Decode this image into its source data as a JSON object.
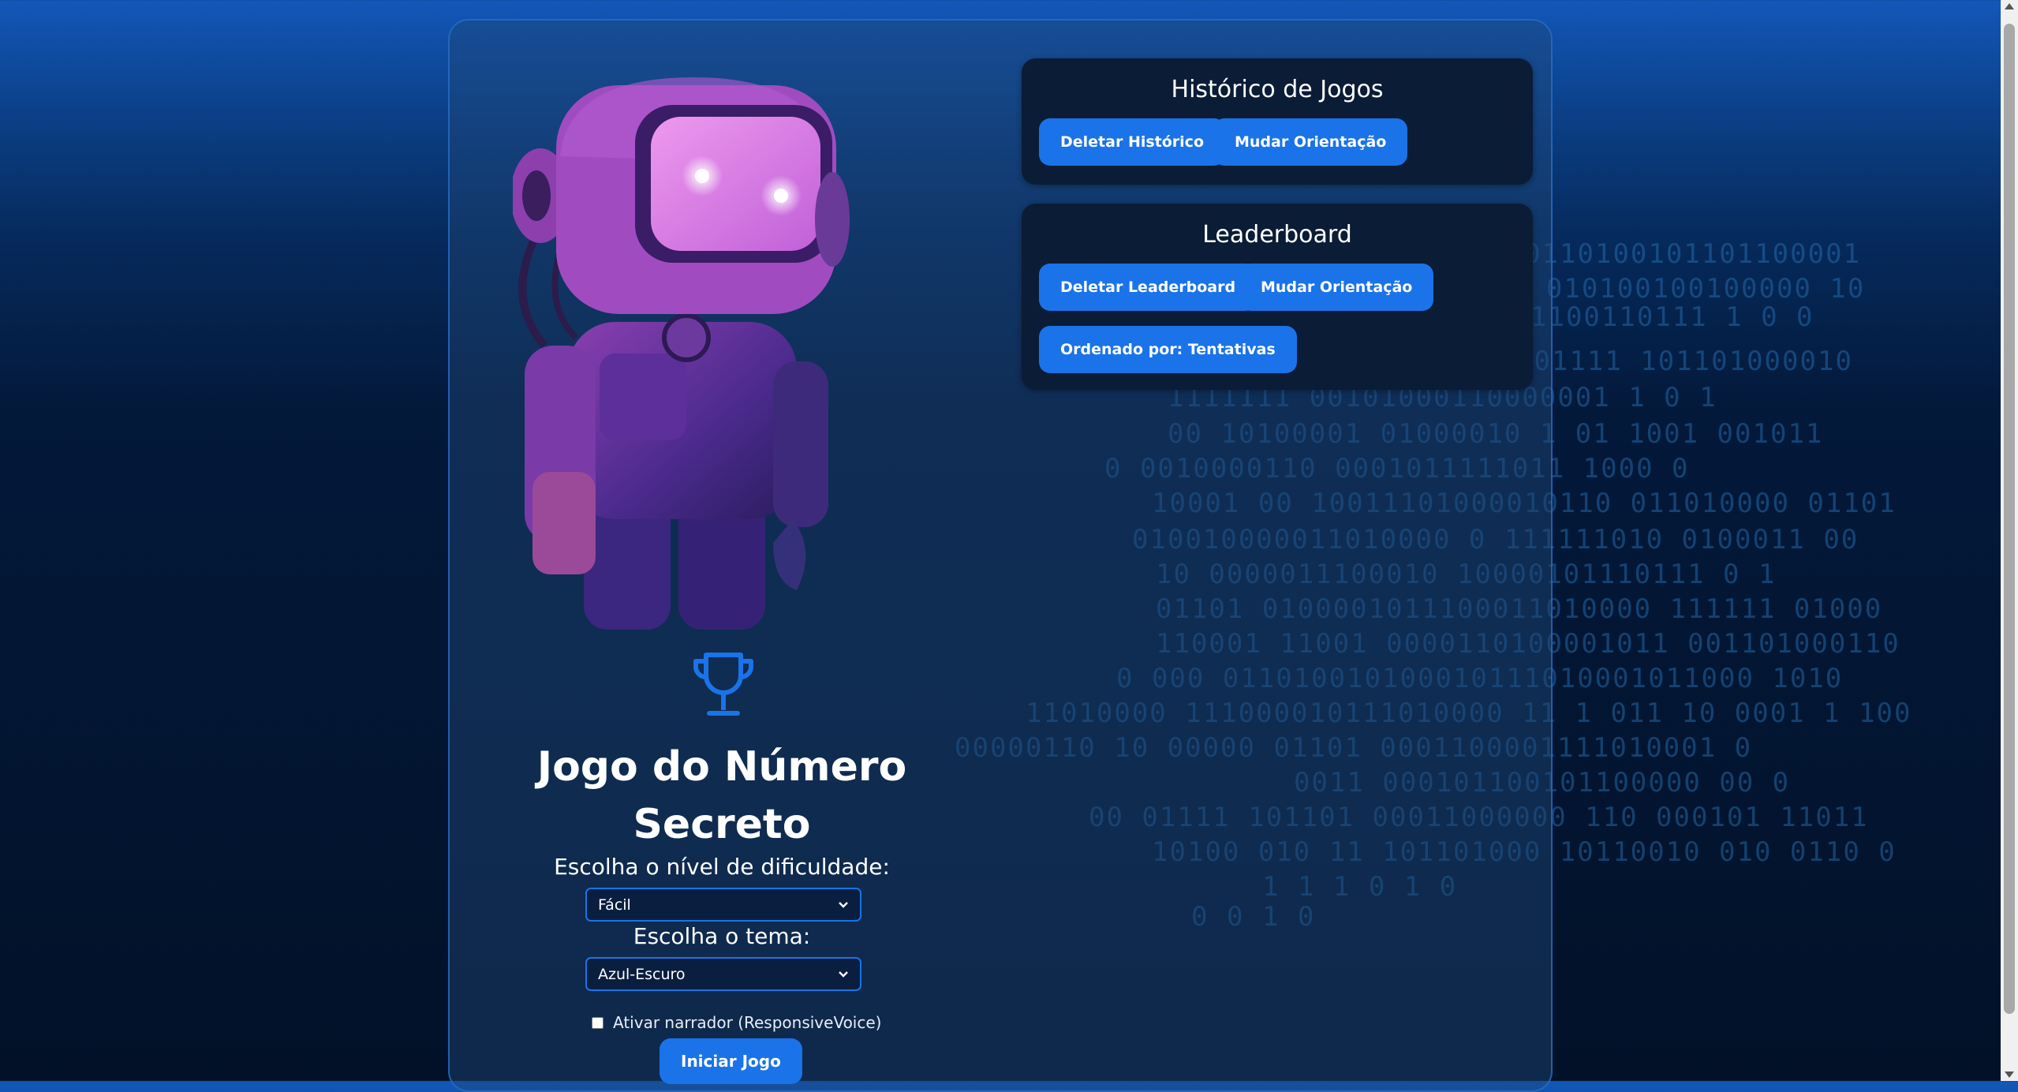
{
  "colors": {
    "accent": "#1a73e8",
    "panel_bg": "#0b1c36",
    "page_top": "#1257b8",
    "page_bottom": "#021128",
    "binary_text": "#2878be"
  },
  "history": {
    "title": "Histórico de Jogos",
    "delete_label": "Deletar Histórico",
    "orientation_label": "Mudar Orientação"
  },
  "leaderboard": {
    "title": "Leaderboard",
    "delete_label": "Deletar Leaderboard",
    "orientation_label": "Mudar Orientação",
    "sort_label": "Ordenado por: Tentativas"
  },
  "game": {
    "title_line1": "Jogo do Número",
    "title_line2": "Secreto",
    "difficulty_label": "Escolha o nível de dificuldade:",
    "difficulty_value": "Fácil",
    "theme_label": "Escolha o tema:",
    "theme_value": "Azul-Escuro",
    "narrator_label": "Ativar narrador (ResponsiveVoice)",
    "start_label": "Iniciar Jogo"
  },
  "icons": {
    "trophy": "trophy-icon",
    "robot": "robot-mascot",
    "select_arrow": "chevron-down-icon"
  },
  "binary_rain": [
    "110111010 10 0110100101101100001",
    "000 010100100100000 10",
    "1100110111 1 0     0",
    "1110100001101 000101111 101101000010",
    "1111111 00101000110000001 1 0  1",
    "00 10100001 01000010 1 01 1001 001011",
    "0 0010000110 0001011111011 1000 0",
    "10001 00 10011101000010110 011010000 01101",
    "010010000011010000 0 111111010 0100011 00",
    "10 0000011100010 10000101110111   0  1",
    "01101 0100001011100011010000 111111 01000",
    "110001 11001 0000110100001011 001101000110",
    "0 000 011010010100010111010001011000 1010",
    "11010000 111000010111010000 11 1 011 10 0001 1 100",
    "00000110 10  00000 01101 0001100001111010001 0",
    "0011 000101100101100000 00   0",
    "00 01111 101101 00011000000 110 000101 11011",
    "10100 010 11 101101000 10110010 010 0110 0",
    "1 1 1 0 1 0",
    "0 0 1 0"
  ]
}
